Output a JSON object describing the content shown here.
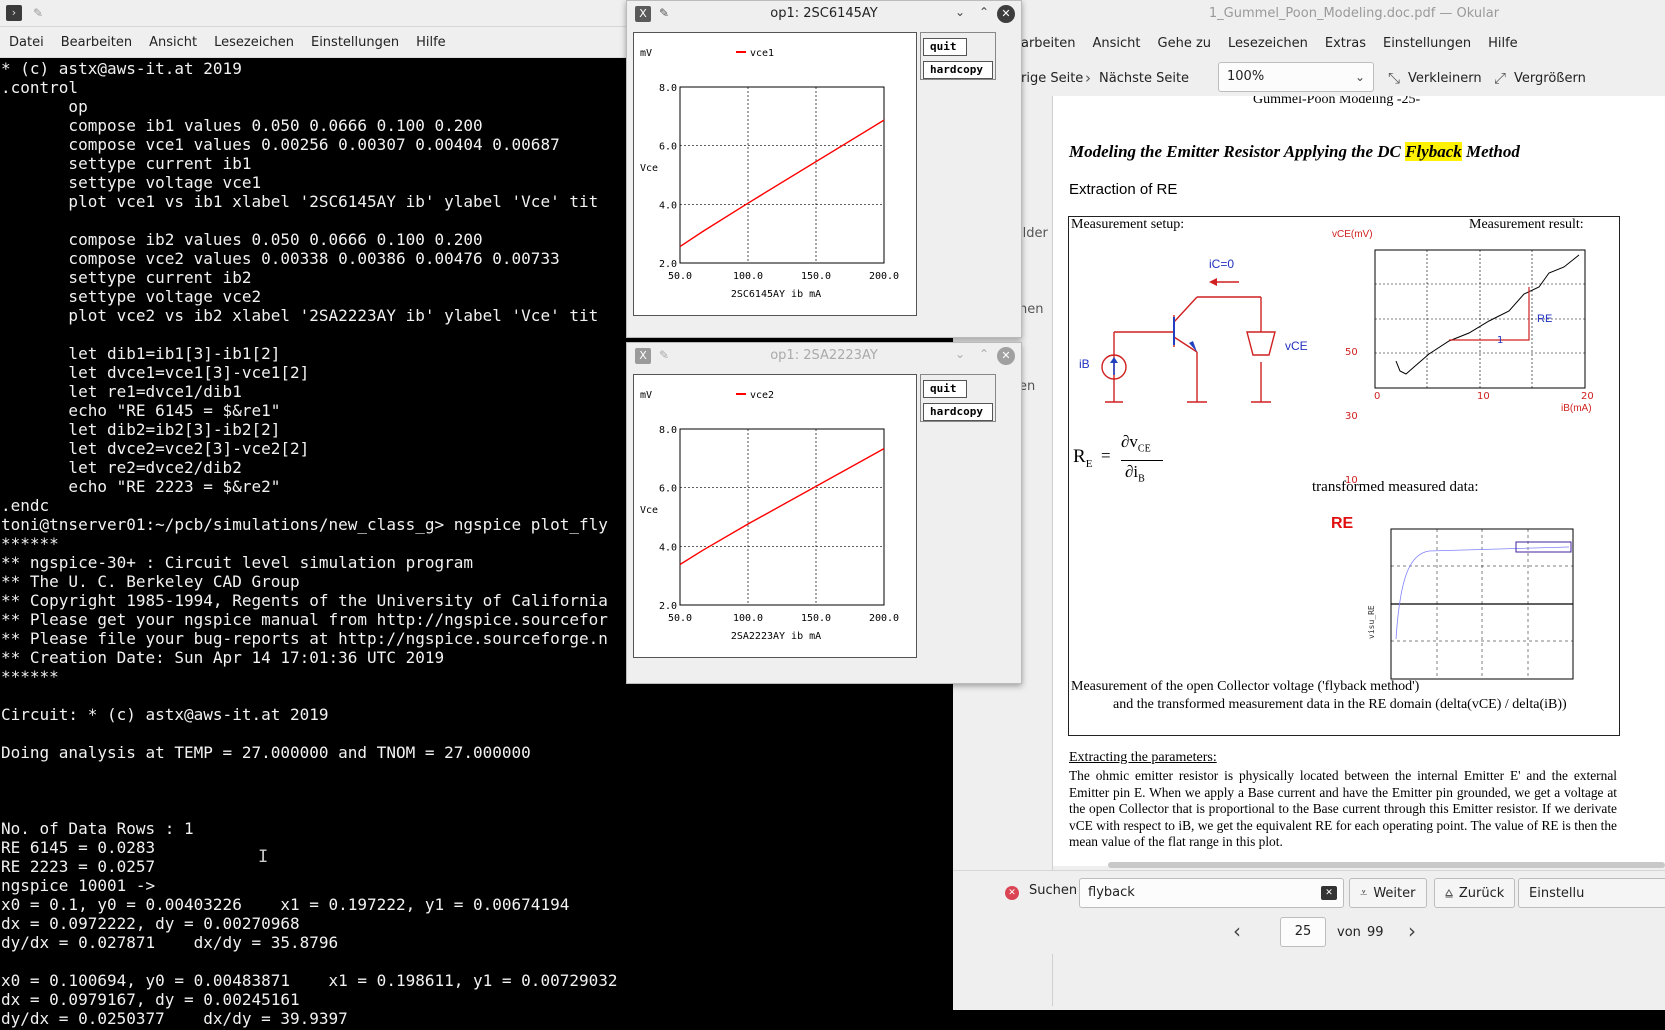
{
  "terminal": {
    "menu": [
      "Datei",
      "Bearbeiten",
      "Ansicht",
      "Lesezeichen",
      "Einstellungen",
      "Hilfe"
    ],
    "lines": [
      "* (c) astx@aws-it.at 2019",
      ".control",
      "       op",
      "       compose ib1 values 0.050 0.0666 0.100 0.200",
      "       compose vce1 values 0.00256 0.00307 0.00404 0.00687",
      "       settype current ib1",
      "       settype voltage vce1",
      "       plot vce1 vs ib1 xlabel '2SC6145AY ib' ylabel 'Vce' tit",
      "",
      "       compose ib2 values 0.050 0.0666 0.100 0.200",
      "       compose vce2 values 0.00338 0.00386 0.00476 0.00733",
      "       settype current ib2",
      "       settype voltage vce2",
      "       plot vce2 vs ib2 xlabel '2SA2223AY ib' ylabel 'Vce' tit",
      "",
      "       let dib1=ib1[3]-ib1[2]",
      "       let dvce1=vce1[3]-vce1[2]",
      "       let re1=dvce1/dib1",
      "       echo \"RE 6145 = $&re1\"",
      "       let dib2=ib2[3]-ib2[2]",
      "       let dvce2=vce2[3]-vce2[2]",
      "       let re2=dvce2/dib2",
      "       echo \"RE 2223 = $&re2\"",
      ".endc",
      "toni@tnserver01:~/pcb/simulations/new_class_g> ngspice plot_fly",
      "******",
      "** ngspice-30+ : Circuit level simulation program",
      "** The U. C. Berkeley CAD Group",
      "** Copyright 1985-1994, Regents of the University of California",
      "** Please get your ngspice manual from http://ngspice.sourcefor",
      "** Please file your bug-reports at http://ngspice.sourceforge.n",
      "** Creation Date: Sun Apr 14 17:01:36 UTC 2019",
      "******",
      "",
      "Circuit: * (c) astx@aws-it.at 2019",
      "",
      "Doing analysis at TEMP = 27.000000 and TNOM = 27.000000",
      "",
      "",
      "",
      "No. of Data Rows : 1",
      "RE 6145 = 0.0283",
      "RE 2223 = 0.0257",
      "ngspice 10001 ->",
      "x0 = 0.1, y0 = 0.00403226    x1 = 0.197222, y1 = 0.00674194",
      "dx = 0.0972222, dy = 0.00270968",
      "dy/dx = 0.027871    dx/dy = 35.8796",
      "",
      "x0 = 0.100694, y0 = 0.00483871    x1 = 0.198611, y1 = 0.00729032",
      "dx = 0.0979167, dy = 0.00245161",
      "dy/dx = 0.0250377    dx/dy = 39.9397"
    ]
  },
  "okular": {
    "title": "1_Gummel_Poon_Modeling.doc.pdf — Okular",
    "menu": [
      "earbeiten",
      "Ansicht",
      "Gehe zu",
      "Lesezeichen",
      "Extras",
      "Einstellungen",
      "Hilfe"
    ],
    "toolbar": {
      "prev_page": "erige Seite",
      "next_page": "Nächste Seite",
      "zoom": "100%",
      "zoom_out": "Verkleinern",
      "zoom_in": "Vergrößern"
    },
    "side_labels": [
      "ilder",
      "hen",
      "en"
    ],
    "find": {
      "label": "Suchen",
      "value": "flyback",
      "next": "Weiter",
      "prev": "Zurück",
      "settings": "Einstellu"
    },
    "page": {
      "current": "25",
      "of_label": "von",
      "total": "99"
    },
    "pdf": {
      "header": "Gummel-Poon Modeling      -25-",
      "heading_pre": "Modeling  the  Emitter  Resistor Applying the DC ",
      "heading_hl": "Flyback",
      "heading_post": " Method",
      "subheading": "Extraction of  RE",
      "setup_label": "Measurement setup:",
      "result_label": "Measurement result:",
      "ic_label": "iC=0",
      "ib_label": "iB",
      "vce_label": "vCE",
      "meas_ylabel": "vCE(mV)",
      "meas_xlabel": "iB(mA)",
      "meas_yticks": [
        "50",
        "30",
        "10"
      ],
      "meas_xticks": [
        "0",
        "10",
        "20"
      ],
      "re_marker": "RE",
      "one_marker": "1",
      "formula_re": "R",
      "formula_sub": "E",
      "formula_num": "∂v",
      "formula_num_sub": "CE",
      "formula_den": "∂i",
      "formula_den_sub": "B",
      "transformed_label": "transformed measured data:",
      "re_red": "RE",
      "caption1": "Measurement of the open Collector voltage ('flyback method')",
      "caption2": "and the transformed measurement data in the RE domain (delta(vCE) / delta(iB))",
      "section": "Extracting the parameters:",
      "paragraph": "The ohmic emitter resistor is physically located between the internal Emitter E' and the external Emitter pin E. When we apply a Base current and have the Emitter pin grounded, we get a voltage at the open Collector that is proportional to the Base current through this Emitter resistor. If we derivate vCE with respect to iB, we get the equivalent RE for each operating point. The value of RE is then the mean value of the flat range in this plot."
    }
  },
  "plots": [
    {
      "title": "op1: 2SC6145AY",
      "quit": "quit",
      "hardcopy": "hardcopy",
      "unit": "mV",
      "legend": "vce1",
      "ylabel": "Vce",
      "xlabel": "2SC6145AY ib mA",
      "yticks": [
        "8.0",
        "6.0",
        "4.0",
        "2.0"
      ],
      "xticks": [
        "50.0",
        "100.0",
        "150.0",
        "200.0"
      ]
    },
    {
      "title": "op1: 2SA2223AY",
      "quit": "quit",
      "hardcopy": "hardcopy",
      "unit": "mV",
      "legend": "vce2",
      "ylabel": "Vce",
      "xlabel": "2SA2223AY ib mA",
      "yticks": [
        "8.0",
        "6.0",
        "4.0",
        "2.0"
      ],
      "xticks": [
        "50.0",
        "100.0",
        "150.0",
        "200.0"
      ]
    }
  ],
  "chart_data": [
    {
      "type": "line",
      "title": "",
      "xlabel": "2SC6145AY ib mA",
      "ylabel": "Vce",
      "xlim": [
        50,
        200
      ],
      "ylim": [
        2,
        8
      ],
      "series": [
        {
          "name": "vce1",
          "x": [
            50,
            66.6,
            100,
            200
          ],
          "y": [
            2.56,
            3.07,
            4.04,
            6.87
          ]
        }
      ],
      "grid": true,
      "legend": "top-center",
      "color": "#ff0000"
    },
    {
      "type": "line",
      "title": "",
      "xlabel": "2SA2223AY ib mA",
      "ylabel": "Vce",
      "xlim": [
        50,
        200
      ],
      "ylim": [
        2,
        8
      ],
      "series": [
        {
          "name": "vce2",
          "x": [
            50,
            66.6,
            100,
            200
          ],
          "y": [
            3.38,
            3.86,
            4.76,
            7.33
          ]
        }
      ],
      "grid": true,
      "legend": "top-center",
      "color": "#ff0000"
    }
  ]
}
